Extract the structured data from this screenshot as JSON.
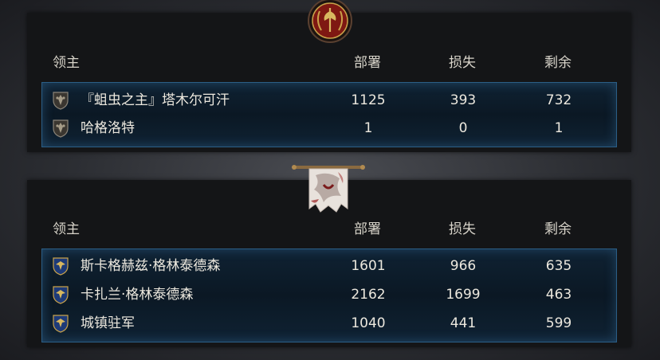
{
  "attacker": {
    "headers": {
      "lord": "领主",
      "deployed": "部署",
      "losses": "损失",
      "remaining": "剩余"
    },
    "rows": [
      {
        "name": "『蛆虫之主』塔木尔可汗",
        "deployed": "1125",
        "losses": "393",
        "remaining": "732",
        "icon": "faction-shield-icon"
      },
      {
        "name": "哈格洛特",
        "deployed": "1",
        "losses": "0",
        "remaining": "1",
        "icon": "faction-shield-icon"
      }
    ],
    "emblem": "laurel-axe-emblem-icon"
  },
  "defender": {
    "headers": {
      "lord": "领主",
      "deployed": "部署",
      "losses": "损失",
      "remaining": "剩余"
    },
    "rows": [
      {
        "name": "斯卡格赫兹·格林泰德森",
        "deployed": "1601",
        "losses": "966",
        "remaining": "635",
        "icon": "eagle-shield-icon"
      },
      {
        "name": "卡扎兰·格林泰德森",
        "deployed": "2162",
        "losses": "1699",
        "remaining": "463",
        "icon": "eagle-shield-icon"
      },
      {
        "name": "城镇驻军",
        "deployed": "1040",
        "losses": "441",
        "remaining": "599",
        "icon": "eagle-shield-icon"
      }
    ],
    "banner": "wolf-banner-icon"
  },
  "colors": {
    "panel": "#141517",
    "row_box_border": "#2b5e86",
    "row_box_bg": "#0b1824",
    "emblem_red": "#8a1a14",
    "gold": "#c9a24a"
  }
}
